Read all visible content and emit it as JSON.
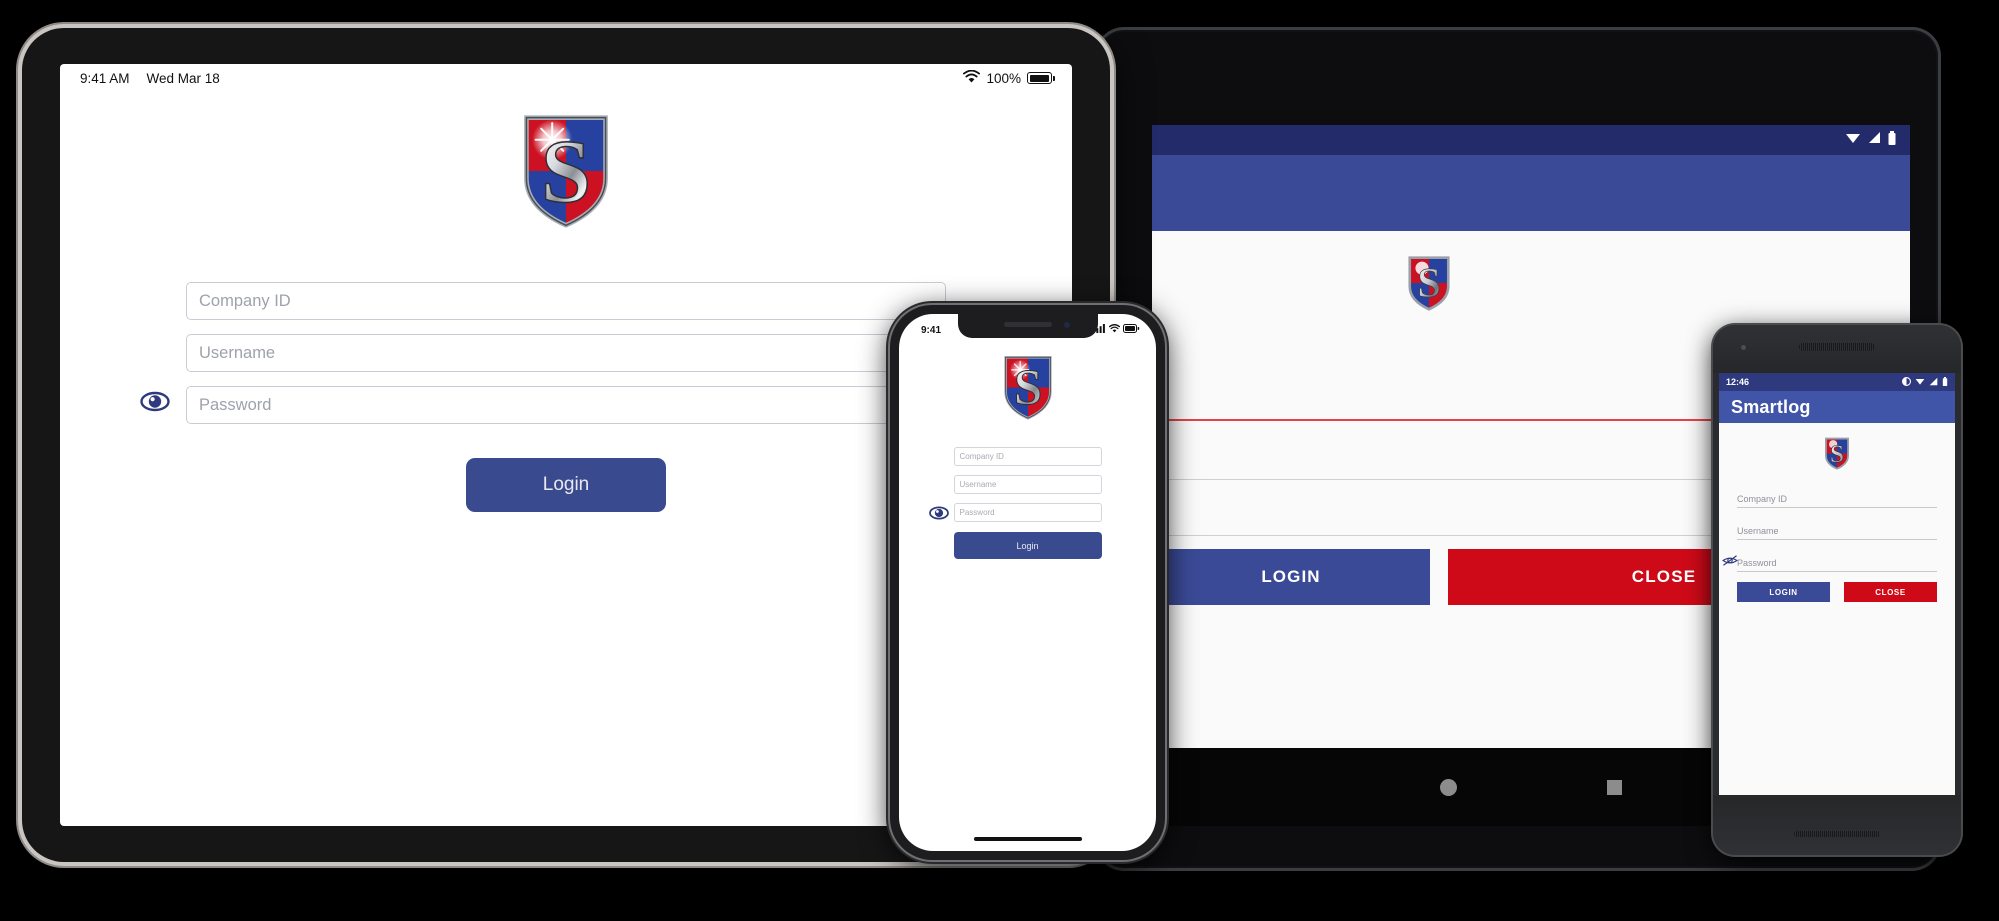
{
  "scene": {
    "background_color": "#000000",
    "description": "Four devices showing the Smartlog login screen"
  },
  "brand": {
    "name": "Smartlog",
    "logo_icon": "shield-s-logo",
    "navy": "#3a4a8f",
    "dark_navy": "#2f3a7e",
    "red": "#cf0a18",
    "shield_red": "#cc1122",
    "shield_blue": "#2741a0"
  },
  "ipad": {
    "device_name": "ipad-device",
    "status_bar": {
      "time": "9:41 AM",
      "date": "Wed Mar 18",
      "wifi_icon": "wifi-icon",
      "battery_percent": "100%",
      "battery_icon": "battery-full-icon"
    },
    "logo_icon": "shield-s-logo",
    "fields": [
      {
        "name": "company-id",
        "placeholder": "Company ID",
        "value": ""
      },
      {
        "name": "username",
        "placeholder": "Username",
        "value": ""
      },
      {
        "name": "password",
        "placeholder": "Password",
        "value": ""
      }
    ],
    "password_toggle_icon": "eye-icon",
    "login_button_label": "Login"
  },
  "iphone": {
    "device_name": "iphone-device",
    "status_bar": {
      "time": "9:41",
      "cellular_icon": "signal-bars-icon",
      "wifi_icon": "wifi-icon",
      "battery_icon": "battery-full-icon"
    },
    "logo_icon": "shield-s-logo",
    "fields": [
      {
        "name": "company-id",
        "placeholder": "Company ID",
        "value": ""
      },
      {
        "name": "username",
        "placeholder": "Username",
        "value": ""
      },
      {
        "name": "password",
        "placeholder": "Password",
        "value": ""
      }
    ],
    "password_toggle_icon": "eye-icon",
    "login_button_label": "Login",
    "home_indicator": "home-indicator"
  },
  "android_tablet": {
    "device_name": "android-tablet-device",
    "status_bar": {
      "wifi_icon": "wifi-icon",
      "signal_icon": "cell-signal-icon",
      "battery_icon": "battery-icon"
    },
    "app_bar_color": "#3a4a96",
    "logo_icon": "shield-s-logo",
    "fields": [
      {
        "name": "company-id",
        "placeholder": "",
        "underline_color": "#e8404a",
        "focused": true
      },
      {
        "name": "username",
        "placeholder": "",
        "underline_color": "#cfcfcf",
        "focused": false
      },
      {
        "name": "password",
        "placeholder": "",
        "underline_color": "#cfcfcf",
        "focused": false
      }
    ],
    "login_button_label": "LOGIN",
    "close_button_label": "CLOSE",
    "nav_bar": {
      "home_icon": "home-circle-icon",
      "recents_icon": "recents-square-icon"
    }
  },
  "android_phone": {
    "device_name": "android-phone-device",
    "status_bar": {
      "time": "12:46",
      "dnd_icon": "do-not-disturb-icon",
      "wifi_icon": "wifi-icon",
      "signal_icon": "cell-signal-icon",
      "battery_icon": "battery-icon"
    },
    "app_bar_title": "Smartlog",
    "logo_icon": "shield-s-logo",
    "fields": [
      {
        "name": "company-id",
        "placeholder": "Company ID",
        "value": ""
      },
      {
        "name": "username",
        "placeholder": "Username",
        "value": ""
      },
      {
        "name": "password",
        "placeholder": "Password",
        "value": ""
      }
    ],
    "password_toggle_icon": "eye-off-icon",
    "login_button_label": "LOGIN",
    "close_button_label": "CLOSE"
  }
}
